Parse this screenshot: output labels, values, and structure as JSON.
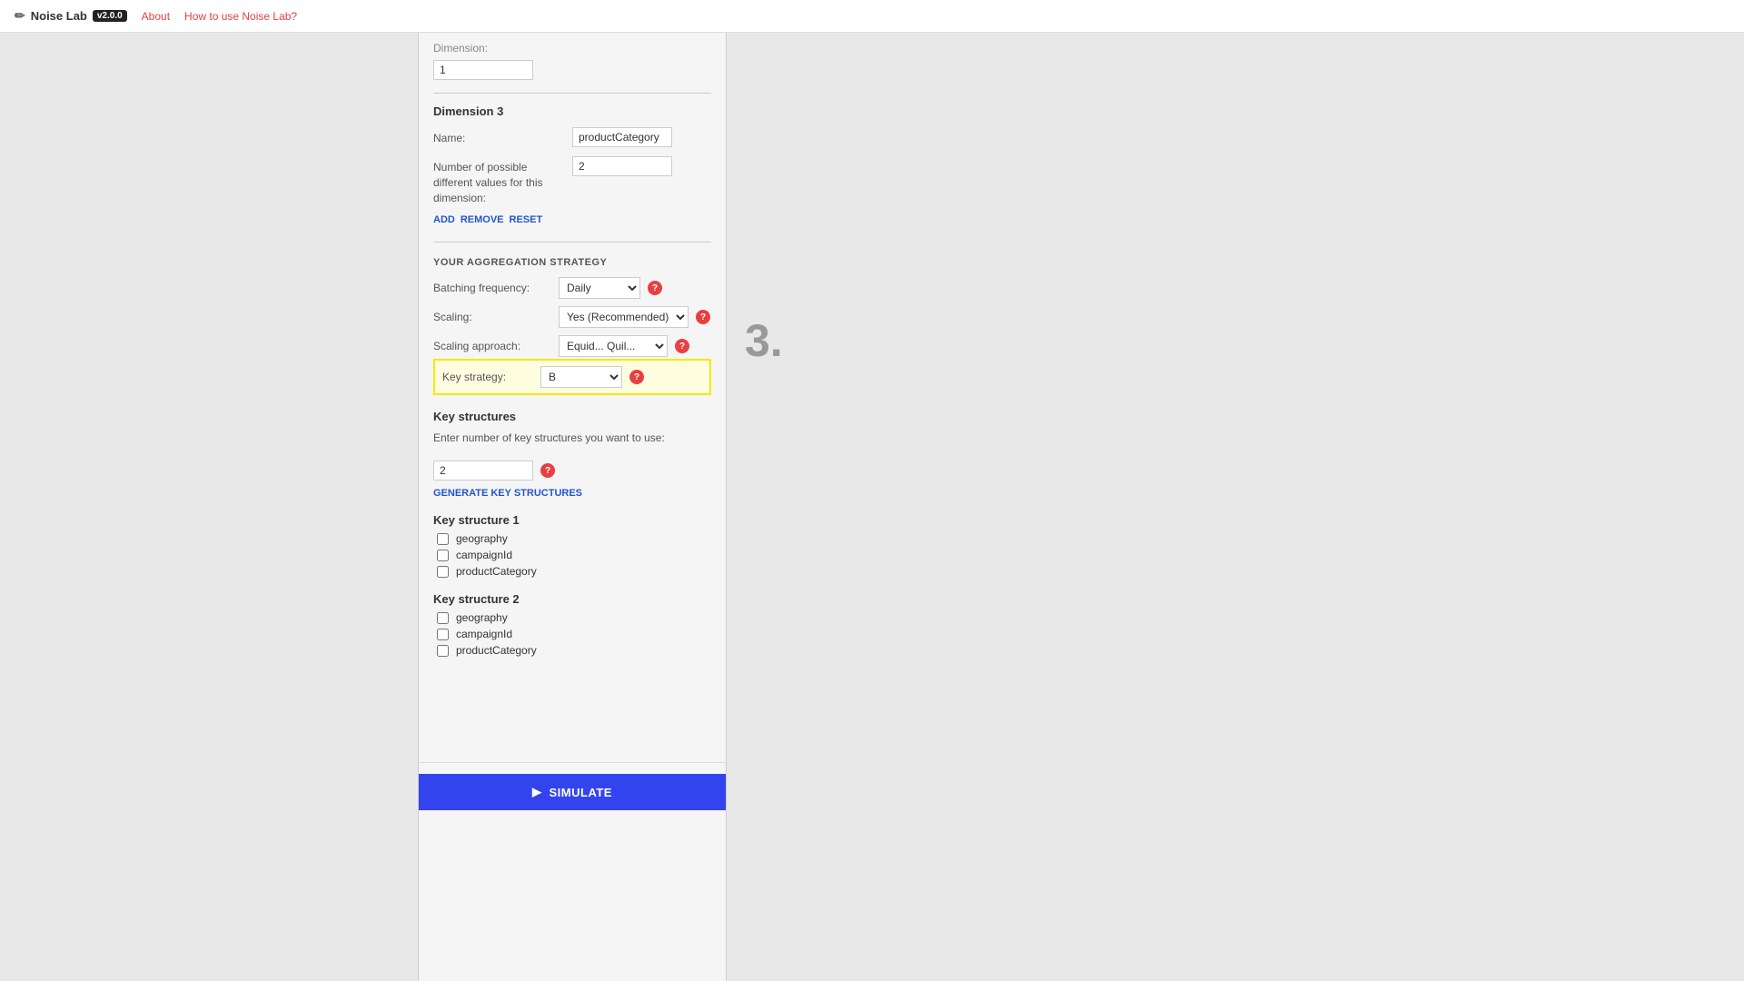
{
  "nav": {
    "logo_icon": "✏",
    "app_name": "Noise Lab",
    "version": "v2.0.0",
    "links": [
      "About",
      "How to use Noise Lab?"
    ]
  },
  "panel": {
    "dimension3": {
      "title": "Dimension 3",
      "name_label": "Name:",
      "name_value": "productCategory",
      "num_values_label": "Number of possible different values for this dimension:",
      "num_values_value": "2",
      "actions": [
        "ADD",
        "REMOVE",
        "RESET"
      ]
    },
    "aggregation_section": {
      "title": "YOUR AGGREGATION STRATEGY",
      "batching_label": "Batching frequency:",
      "batching_value": "Daily",
      "scaling_label": "Scaling:",
      "scaling_value": "Yes (Recommended)",
      "scaling_approach_label": "Scaling approach:",
      "scaling_approach_value": "Equid... Quil...",
      "key_strategy_label": "Key strategy:",
      "key_strategy_value": "B"
    },
    "key_structures": {
      "title": "Key structures",
      "description": "Enter number of key structures you want to use:",
      "num_value": "2",
      "generate_link": "GENERATE KEY STRUCTURES",
      "groups": [
        {
          "title": "Key structure 1",
          "items": [
            "geography",
            "campaignId",
            "productCategory"
          ]
        },
        {
          "title": "Key structure 2",
          "items": [
            "geography",
            "campaignId",
            "productCategory"
          ]
        }
      ]
    },
    "simulate_button": "SIMULATE"
  },
  "annotation": "3."
}
